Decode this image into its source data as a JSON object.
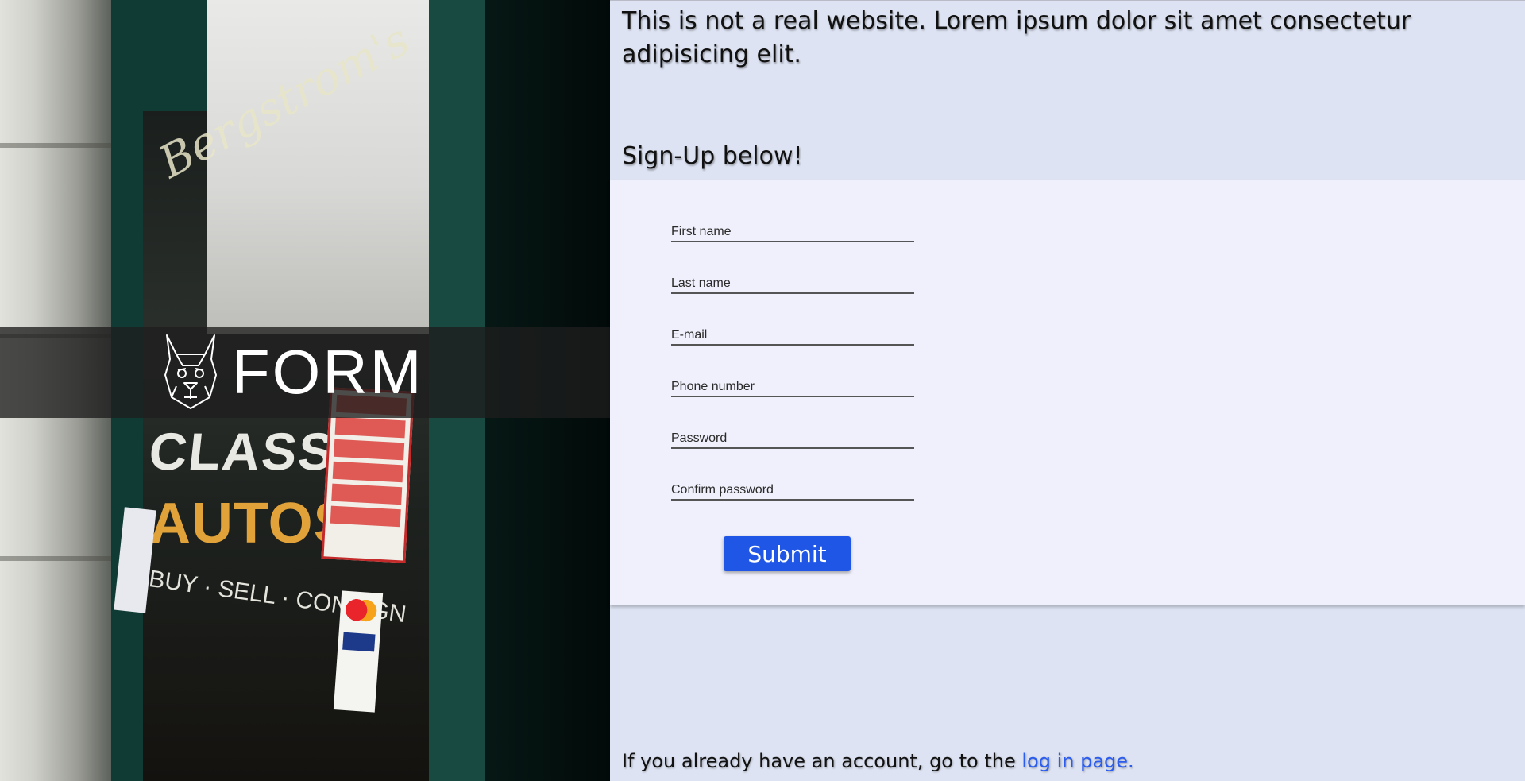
{
  "brand": {
    "name": "FORM"
  },
  "header": {
    "notice": "This is not a real website. Lorem ipsum dolor sit amet consectetur adipisicing elit.",
    "signup_heading": "Sign-Up below!"
  },
  "form": {
    "fields": [
      {
        "placeholder": "First name",
        "type": "text",
        "value": ""
      },
      {
        "placeholder": "Last name",
        "type": "text",
        "value": ""
      },
      {
        "placeholder": "E-mail",
        "type": "email",
        "value": ""
      },
      {
        "placeholder": "Phone number",
        "type": "tel",
        "value": ""
      },
      {
        "placeholder": "Password",
        "type": "password",
        "value": ""
      },
      {
        "placeholder": "Confirm password",
        "type": "password",
        "value": ""
      }
    ],
    "submit_label": "Submit"
  },
  "footer": {
    "login_prefix": "If you already have an account, go to the ",
    "login_link": "log in page."
  },
  "photo": {
    "shop_script": "Bergstrom's",
    "shop_classic": "CLASSIC",
    "shop_autos": "AUTOS",
    "shop_buy": "BUY · SELL · CONSIGN"
  },
  "colors": {
    "accent": "#1f56e6",
    "link": "#2a5cf0",
    "background": "#dde3f2",
    "panel": "#f0f0fc"
  }
}
